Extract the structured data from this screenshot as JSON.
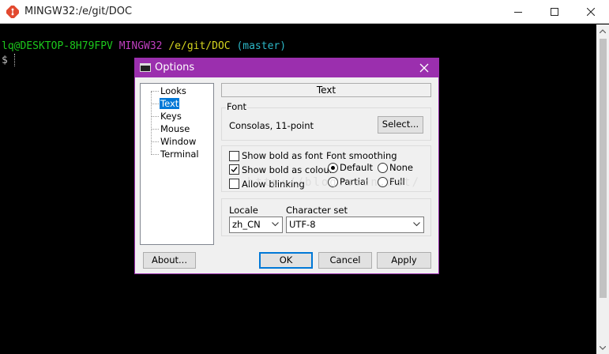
{
  "window": {
    "title": "MINGW32:/e/git/DOC"
  },
  "terminal": {
    "prompt_user": "lq@DESKTOP-8H79FPV",
    "prompt_system": "MINGW32",
    "prompt_path": "/e/git/DOC",
    "prompt_branch": "(master)",
    "dollar": "$"
  },
  "dialog": {
    "title": "Options",
    "nav_items": [
      {
        "label": "Looks"
      },
      {
        "label": "Text",
        "selected": true
      },
      {
        "label": "Keys"
      },
      {
        "label": "Mouse"
      },
      {
        "label": "Window"
      },
      {
        "label": "Terminal"
      }
    ],
    "section_header": "Text",
    "font": {
      "group_label": "Font",
      "value": "Consolas, 11-point",
      "select_button": "Select..."
    },
    "options": {
      "show_bold_as_font": {
        "label": "Show bold as font",
        "checked": false
      },
      "show_bold_as_colour": {
        "label": "Show bold as colour",
        "checked": true
      },
      "allow_blinking": {
        "label": "Allow blinking",
        "checked": false
      }
    },
    "font_smoothing": {
      "label": "Font smoothing",
      "options": [
        "Default",
        "None",
        "Partial",
        "Full"
      ],
      "selected": "Default"
    },
    "locale": {
      "label": "Locale",
      "value": "zh_CN"
    },
    "charset": {
      "label": "Character set",
      "value": "UTF-8"
    },
    "watermark": "http://blog.csdn.net/",
    "buttons": {
      "about": "About...",
      "ok": "OK",
      "cancel": "Cancel",
      "apply": "Apply"
    }
  },
  "colors": {
    "dialog_accent": "#9b2fae",
    "selection": "#0078d7",
    "prompt_user": "#1cc71c",
    "prompt_system": "#bf3fbf",
    "prompt_path": "#d6d61f",
    "prompt_branch": "#2cb7c7"
  }
}
